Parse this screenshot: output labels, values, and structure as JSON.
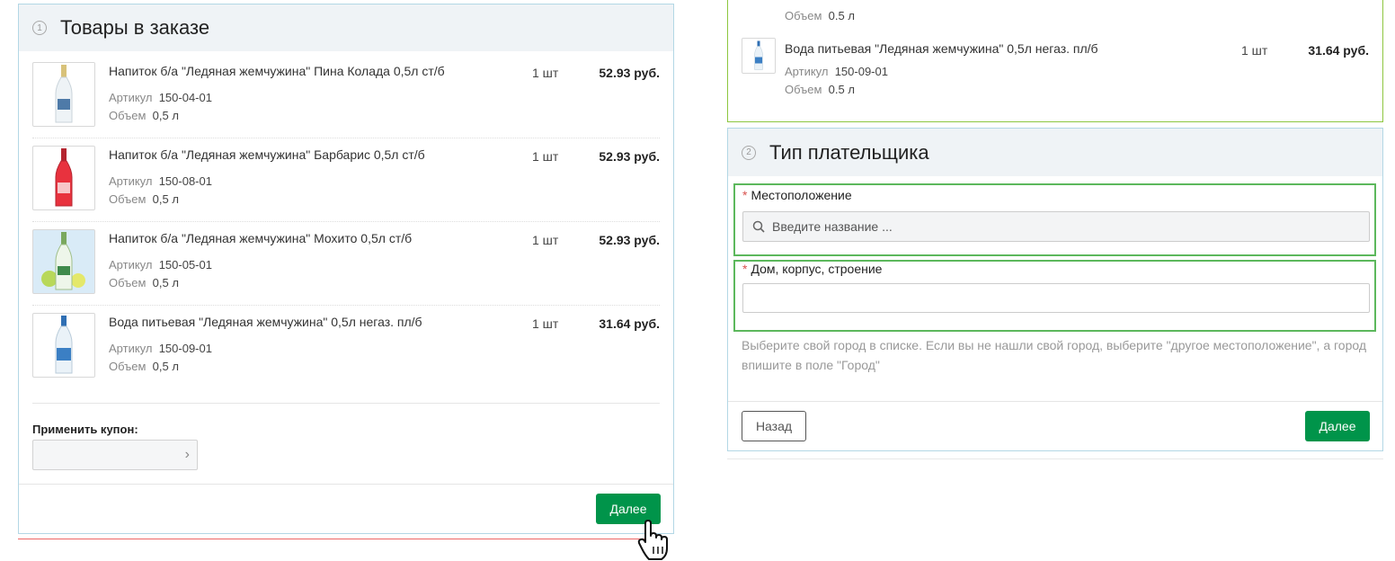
{
  "order_panel": {
    "step": "1",
    "title": "Товары в заказе",
    "items": [
      {
        "name": "Напиток б/а \"Ледяная жемчужина\" Пина Колада 0,5л ст/б",
        "article_label": "Артикул",
        "article": "150-04-01",
        "volume_label": "Объем",
        "volume": "0,5 л",
        "qty": "1 шт",
        "price": "52.93 руб.",
        "thumb_color": "#e9eef2"
      },
      {
        "name": "Напиток б/а \"Ледяная жемчужина\" Барбарис 0,5л ст/б",
        "article_label": "Артикул",
        "article": "150-08-01",
        "volume_label": "Объем",
        "volume": "0,5 л",
        "qty": "1 шт",
        "price": "52.93 руб.",
        "thumb_color": "#e8323e"
      },
      {
        "name": "Напиток б/а \"Ледяная жемчужина\" Мохито 0,5л ст/б",
        "article_label": "Артикул",
        "article": "150-05-01",
        "volume_label": "Объем",
        "volume": "0,5 л",
        "qty": "1 шт",
        "price": "52.93 руб.",
        "thumb_color": "#cfe3c0"
      },
      {
        "name": "Вода питьевая \"Ледяная жемчужина\" 0,5л негаз. пл/б",
        "article_label": "Артикул",
        "article": "150-09-01",
        "volume_label": "Объем",
        "volume": "0,5 л",
        "qty": "1 шт",
        "price": "31.64 руб.",
        "thumb_color": "#dbe9f3"
      }
    ],
    "coupon_label": "Применить купон:",
    "coupon_chevron": "›",
    "next_label": "Далее"
  },
  "summary_box": {
    "top_volume_label": "Объем",
    "top_volume": "0.5 л",
    "item": {
      "name": "Вода питьевая \"Ледяная жемчужина\" 0,5л негаз. пл/б",
      "article_label": "Артикул",
      "article": "150-09-01",
      "volume_label": "Объем",
      "volume": "0.5 л",
      "qty": "1 шт",
      "price": "31.64 руб."
    }
  },
  "payer_panel": {
    "step": "2",
    "title": "Тип плательщика",
    "location_label": "Местоположение",
    "location_placeholder": "Введите название ...",
    "house_label": "Дом, корпус, строение",
    "required_mark": "*",
    "hint": "Выберите свой город в списке. Если вы не нашли свой город, выберите \"другое местоположение\", а город впишите в поле \"Город\"",
    "back_label": "Назад",
    "next_label": "Далее"
  },
  "colors": {
    "accent_green": "#00944a",
    "field_highlight": "#5cb85c",
    "panel_border": "#b3d7e5",
    "panel_head_bg": "#eff3f6"
  }
}
